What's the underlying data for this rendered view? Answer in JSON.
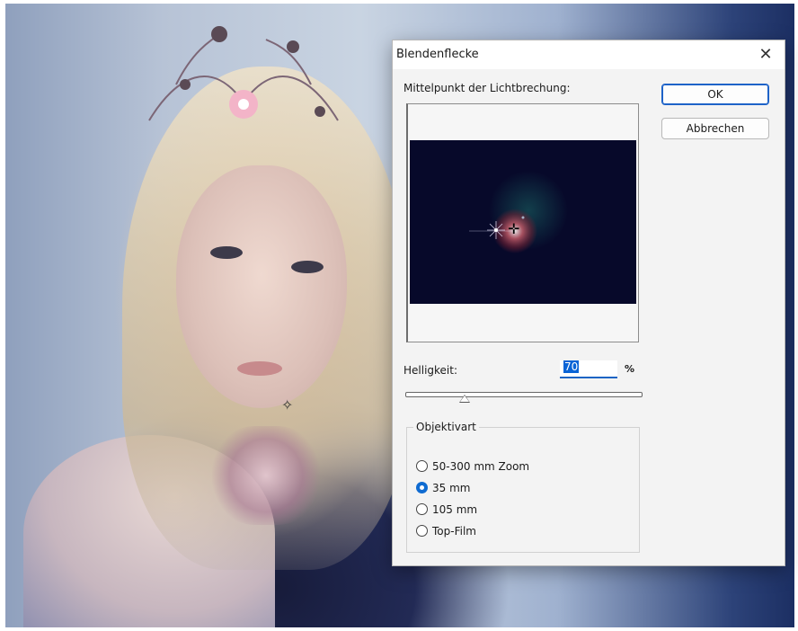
{
  "dialog": {
    "title": "Blendenflecke",
    "close_glyph": "✕",
    "center_label": "Mittelpunkt der Lichtbrechung:",
    "ok_label": "OK",
    "cancel_label": "Abbrechen",
    "brightness_label": "Helligkeit:",
    "brightness_value": "70",
    "brightness_unit": "%",
    "brightness_slider_fraction": 0.25,
    "lens_group_title": "Objektivart",
    "lens_options": [
      {
        "label": "50-300 mm Zoom",
        "checked": false
      },
      {
        "label": "35 mm",
        "checked": true
      },
      {
        "label": "105 mm",
        "checked": false
      },
      {
        "label": "Top-Film",
        "checked": false
      }
    ]
  },
  "colors": {
    "accent": "#1e63c8",
    "preview_bg": "#07092a"
  },
  "icons": {
    "close": "close-icon",
    "crosshair": "crosshair-icon",
    "canvas_cursor": "crosshair-cursor-icon"
  }
}
